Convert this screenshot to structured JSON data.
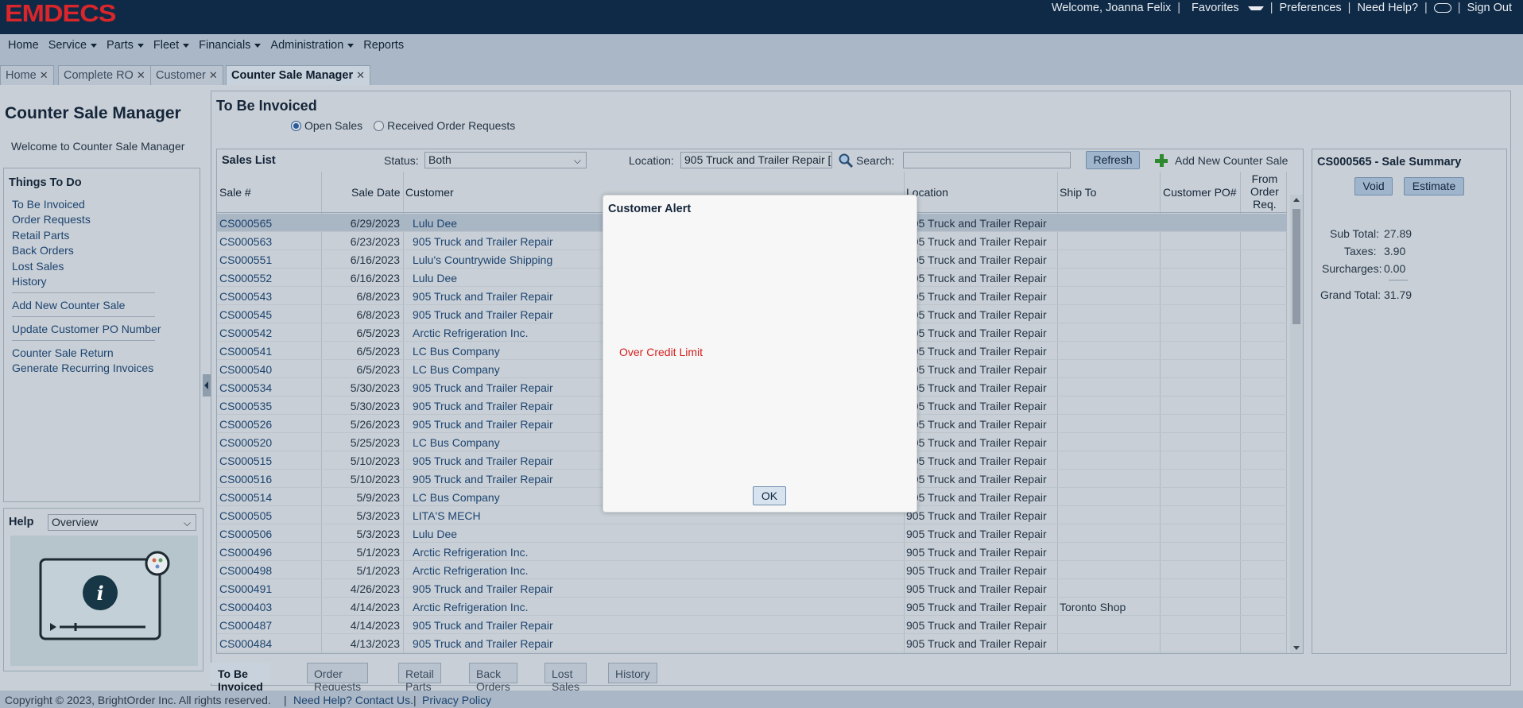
{
  "header": {
    "logo_text": "EMDECS",
    "welcome": "Welcome, Joanna Felix",
    "favorites": "Favorites",
    "preferences": "Preferences",
    "need_help": "Need Help?",
    "sign_out": "Sign Out",
    "sep": "|"
  },
  "nav": {
    "home": "Home",
    "service": "Service",
    "parts": "Parts",
    "fleet": "Fleet",
    "financials": "Financials",
    "administration": "Administration",
    "reports": "Reports"
  },
  "tabs": [
    {
      "label": "Home"
    },
    {
      "label": "Complete RO"
    },
    {
      "label": "Customer"
    },
    {
      "label": "Counter Sale Manager"
    }
  ],
  "tab_close": "✕",
  "left": {
    "title": "Counter Sale Manager",
    "welcome": "Welcome to Counter Sale Manager",
    "things_to_do": "Things To Do",
    "links": {
      "to_be_invoiced": "To Be Invoiced",
      "order_requests": "Order Requests",
      "retail_parts": "Retail Parts",
      "back_orders": "Back Orders",
      "lost_sales": "Lost Sales",
      "history": "History",
      "add_new": "Add New Counter Sale",
      "update_po": "Update Customer PO Number",
      "return": "Counter Sale Return",
      "recurring": "Generate Recurring Invoices"
    },
    "help_label": "Help",
    "help_select": "Overview"
  },
  "main": {
    "title": "To Be Invoiced",
    "radio_open": "Open Sales",
    "radio_received": "Received Order Requests",
    "sales_list_title": "Sales List",
    "status_label": "Status:",
    "status_value": "Both",
    "location_label": "Location:",
    "location_value": "905 Truck and Trailer Repair [",
    "search_label": "Search:",
    "search_value": "",
    "refresh": "Refresh",
    "add_new": "Add New Counter Sale"
  },
  "table": {
    "headers": {
      "sale": "Sale #",
      "date": "Sale Date",
      "customer": "Customer",
      "location": "Location",
      "ship_to": "Ship To",
      "po": "Customer PO#",
      "from1": "From",
      "from2": "Order",
      "from3": "Req."
    },
    "rows": [
      {
        "sale": "CS000565",
        "date": "6/29/2023",
        "customer": "Lulu Dee",
        "location": "905 Truck and Trailer Repair",
        "ship": ""
      },
      {
        "sale": "CS000563",
        "date": "6/23/2023",
        "customer": "905 Truck and Trailer Repair",
        "location": "905 Truck and Trailer Repair",
        "ship": ""
      },
      {
        "sale": "CS000551",
        "date": "6/16/2023",
        "customer": "Lulu's Countrywide Shipping",
        "location": "905 Truck and Trailer Repair",
        "ship": ""
      },
      {
        "sale": "CS000552",
        "date": "6/16/2023",
        "customer": "Lulu Dee",
        "location": "905 Truck and Trailer Repair",
        "ship": ""
      },
      {
        "sale": "CS000543",
        "date": "6/8/2023",
        "customer": "905 Truck and Trailer Repair",
        "location": "905 Truck and Trailer Repair",
        "ship": ""
      },
      {
        "sale": "CS000545",
        "date": "6/8/2023",
        "customer": "905 Truck and Trailer Repair",
        "location": "905 Truck and Trailer Repair",
        "ship": ""
      },
      {
        "sale": "CS000542",
        "date": "6/5/2023",
        "customer": "Arctic Refrigeration Inc.",
        "location": "905 Truck and Trailer Repair",
        "ship": ""
      },
      {
        "sale": "CS000541",
        "date": "6/5/2023",
        "customer": "LC Bus Company",
        "location": "905 Truck and Trailer Repair",
        "ship": ""
      },
      {
        "sale": "CS000540",
        "date": "6/5/2023",
        "customer": "LC Bus Company",
        "location": "905 Truck and Trailer Repair",
        "ship": ""
      },
      {
        "sale": "CS000534",
        "date": "5/30/2023",
        "customer": "905 Truck and Trailer Repair",
        "location": "905 Truck and Trailer Repair",
        "ship": ""
      },
      {
        "sale": "CS000535",
        "date": "5/30/2023",
        "customer": "905 Truck and Trailer Repair",
        "location": "905 Truck and Trailer Repair",
        "ship": ""
      },
      {
        "sale": "CS000526",
        "date": "5/26/2023",
        "customer": "905 Truck and Trailer Repair",
        "location": "905 Truck and Trailer Repair",
        "ship": ""
      },
      {
        "sale": "CS000520",
        "date": "5/25/2023",
        "customer": "LC Bus Company",
        "location": "905 Truck and Trailer Repair",
        "ship": ""
      },
      {
        "sale": "CS000515",
        "date": "5/10/2023",
        "customer": "905 Truck and Trailer Repair",
        "location": "905 Truck and Trailer Repair",
        "ship": ""
      },
      {
        "sale": "CS000516",
        "date": "5/10/2023",
        "customer": "905 Truck and Trailer Repair",
        "location": "905 Truck and Trailer Repair",
        "ship": ""
      },
      {
        "sale": "CS000514",
        "date": "5/9/2023",
        "customer": "LC Bus Company",
        "location": "905 Truck and Trailer Repair",
        "ship": ""
      },
      {
        "sale": "CS000505",
        "date": "5/3/2023",
        "customer": "LITA'S MECH",
        "location": "905 Truck and Trailer Repair",
        "ship": ""
      },
      {
        "sale": "CS000506",
        "date": "5/3/2023",
        "customer": "Lulu Dee",
        "location": "905 Truck and Trailer Repair",
        "ship": ""
      },
      {
        "sale": "CS000496",
        "date": "5/1/2023",
        "customer": "Arctic Refrigeration Inc.",
        "location": "905 Truck and Trailer Repair",
        "ship": ""
      },
      {
        "sale": "CS000498",
        "date": "5/1/2023",
        "customer": "Arctic Refrigeration Inc.",
        "location": "905 Truck and Trailer Repair",
        "ship": ""
      },
      {
        "sale": "CS000491",
        "date": "4/26/2023",
        "customer": "905 Truck and Trailer Repair",
        "location": "905 Truck and Trailer Repair",
        "ship": ""
      },
      {
        "sale": "CS000403",
        "date": "4/14/2023",
        "customer": "Arctic Refrigeration Inc.",
        "location": "905 Truck and Trailer Repair",
        "ship": "Toronto Shop"
      },
      {
        "sale": "CS000487",
        "date": "4/14/2023",
        "customer": "905 Truck and Trailer Repair",
        "location": "905 Truck and Trailer Repair",
        "ship": ""
      },
      {
        "sale": "CS000484",
        "date": "4/13/2023",
        "customer": "905 Truck and Trailer Repair",
        "location": "905 Truck and Trailer Repair",
        "ship": ""
      }
    ]
  },
  "summary": {
    "title": "CS000565 - Sale Summary",
    "void": "Void",
    "estimate": "Estimate",
    "subtotal_label": "Sub Total:",
    "subtotal": "27.89",
    "taxes_label": "Taxes:",
    "taxes": "3.90",
    "surcharges_label": "Surcharges:",
    "surcharges": "0.00",
    "grand_label": "Grand Total:",
    "grand": "31.79"
  },
  "bottom_tabs": {
    "to_be_invoiced": "To Be Invoiced",
    "order_requests": "Order Requests",
    "retail_parts": "Retail Parts",
    "back_orders": "Back Orders",
    "lost_sales": "Lost Sales",
    "history": "History"
  },
  "footer": {
    "copyright": "Copyright © 2023, BrightOrder Inc. All rights reserved.",
    "help": "Need Help? Contact Us.",
    "privacy": "Privacy Policy",
    "sep": "|"
  },
  "modal": {
    "title": "Customer Alert",
    "message": "Over Credit Limit",
    "ok": "OK"
  },
  "colors": {
    "topbar": "#0f2a47",
    "logo": "#d8262b",
    "alert_text": "#d42020",
    "link": "#1d4470"
  }
}
